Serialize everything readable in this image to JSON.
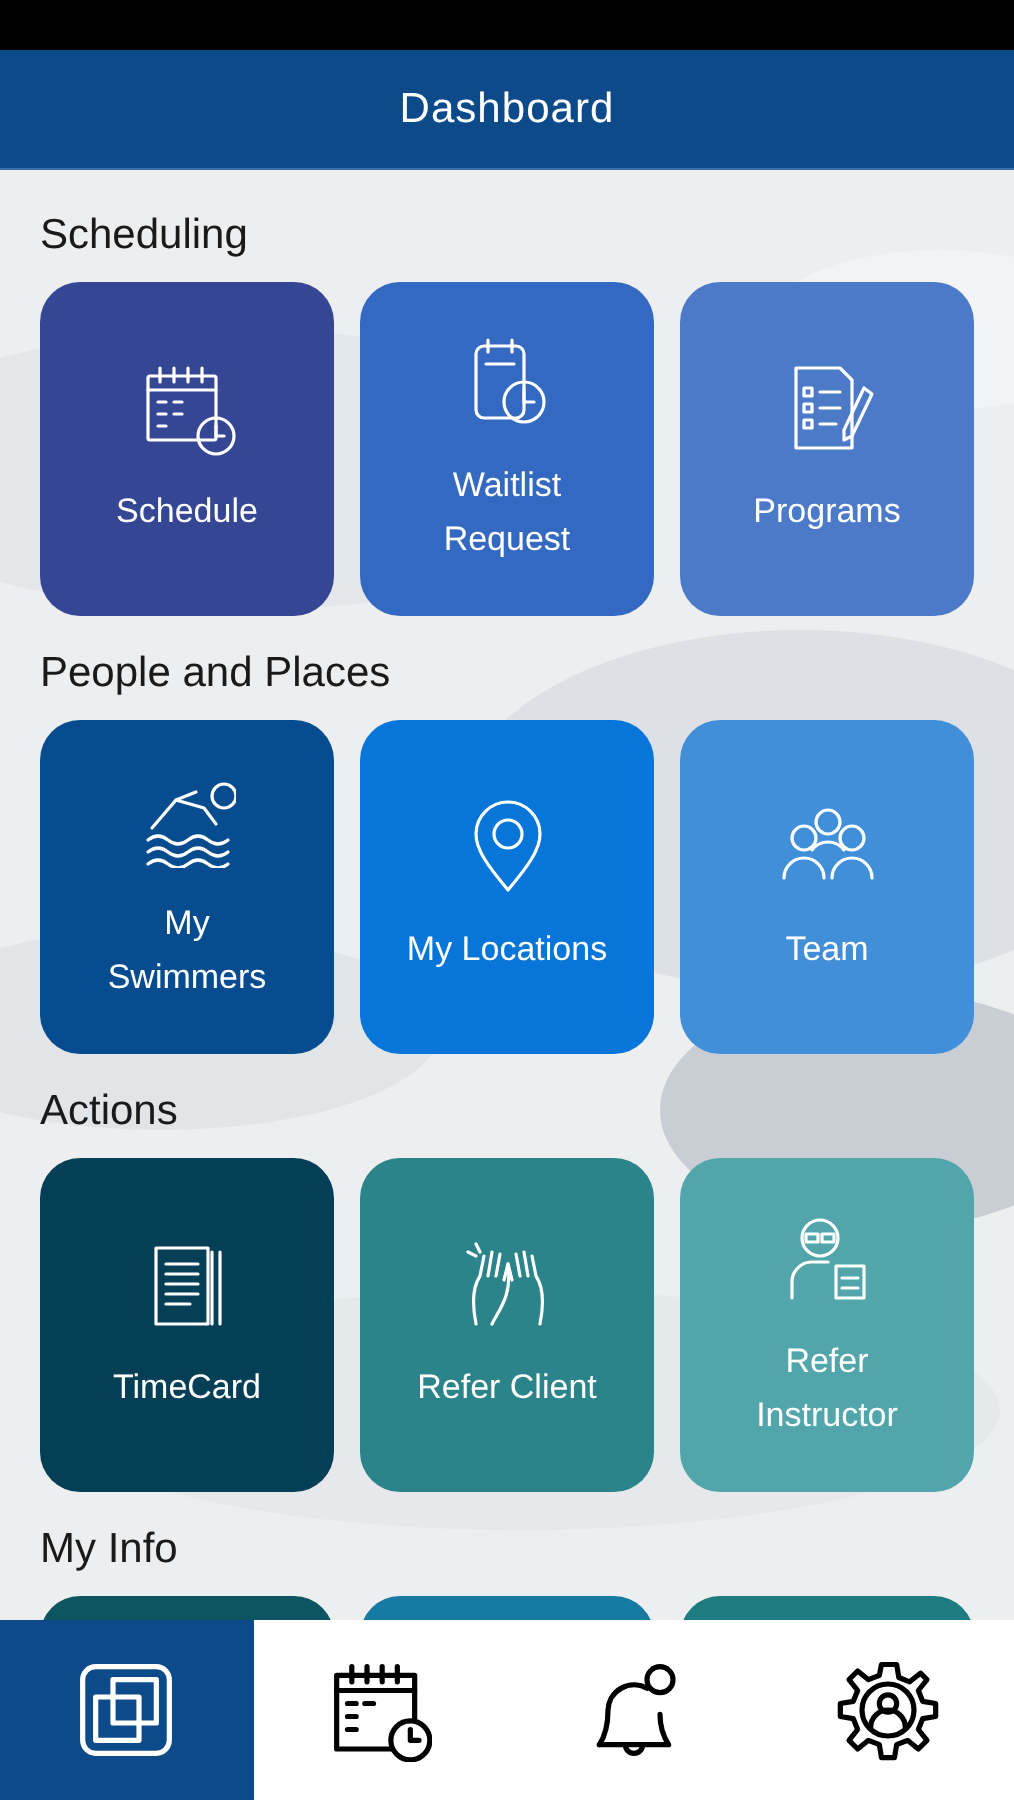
{
  "header": {
    "title": "Dashboard"
  },
  "sections": [
    {
      "title": "Scheduling",
      "tiles": [
        {
          "label": "Schedule",
          "color": "#354694"
        },
        {
          "label": "Waitlist Request",
          "color": "#3469c2"
        },
        {
          "label": "Programs",
          "color": "#4c7ac9"
        }
      ]
    },
    {
      "title": "People and Places",
      "tiles": [
        {
          "label": "My Swimmers",
          "color": "#074c8f"
        },
        {
          "label": "My Locations",
          "color": "#0876d8"
        },
        {
          "label": "Team",
          "color": "#418fd8"
        }
      ]
    },
    {
      "title": "Actions",
      "tiles": [
        {
          "label": "TimeCard",
          "color": "#053f55"
        },
        {
          "label": "Refer Client",
          "color": "#2a8489"
        },
        {
          "label": "Refer Instructor",
          "color": "#52a6ab"
        }
      ]
    },
    {
      "title": "My Info",
      "tiles": [
        {
          "color": "#0d5560"
        },
        {
          "color": "#177aa3"
        },
        {
          "color": "#1e7b80"
        }
      ]
    }
  ],
  "nav": [
    {
      "selected": true
    },
    {
      "selected": false
    },
    {
      "selected": false
    },
    {
      "selected": false
    }
  ]
}
